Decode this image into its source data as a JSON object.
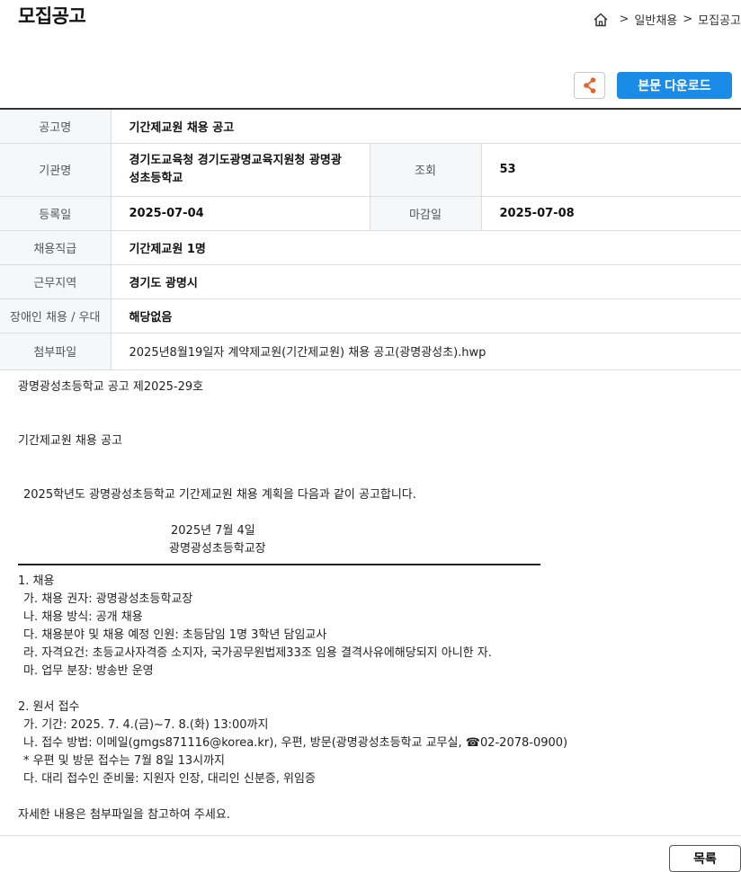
{
  "header": {
    "title": "모집공고",
    "breadcrumb": [
      ">",
      "일반채용",
      ">",
      "모집공고"
    ]
  },
  "actions": {
    "share_icon": "share-icon",
    "download_label": "본문 다운로드"
  },
  "info": {
    "notice_name_label": "공고명",
    "notice_name": "기간제교원 채용 공고",
    "org_label": "기관명",
    "org": "경기도교육청 경기도광명교육지원청 광명광성초등학교",
    "views_label": "조회",
    "views": "53",
    "reg_date_label": "등록일",
    "reg_date": "2025-07-04",
    "deadline_label": "마감일",
    "deadline": "2025-07-08",
    "position_label": "채용직급",
    "position": "기간제교원 1명",
    "region_label": "근무지역",
    "region": "경기도 광명시",
    "disabled_label": "장애인 채용 / 우대",
    "disabled": "해당없음",
    "attachment_label": "첨부파일",
    "attachment": "2025년8월19일자 계약제교원(기간제교원) 채용 공고(광명광성초).hwp"
  },
  "content": {
    "line1": "광명광성초등학교 공고 제2025-29호",
    "line2": "기간제교원 채용 공고",
    "line3": "2025학년도 광명광성초등학교 기간제교원 채용 계획을 다음과 같이 공고합니다.",
    "date": "2025년 7월 4일",
    "signer": "광명광성초등학교장",
    "s1_title": "1. 채용",
    "s1_a": "가. 채용 권자: 광명광성초등학교장",
    "s1_b": "나. 채용 방식: 공개 채용",
    "s1_c": "다. 채용분야 및 채용 예정 인원: 초등담임 1명 3학년 담임교사",
    "s1_d": "라. 자격요건: 초등교사자격증 소지자, 국가공무원법제33조 임용 결격사유에해당되지 아니한 자.",
    "s1_e": "마. 업무 분장: 방송반 운영",
    "s2_title": "2. 원서 접수",
    "s2_a": "가. 기간: 2025. 7. 4.(금)~7. 8.(화) 13:00까지",
    "s2_b": "나. 접수 방법: 이메일(gmgs871116@korea.kr), 우편, 방문(광명광성초등학교 교무실, ☎02-2078-0900)",
    "s2_note": " * 우편 및 방문 접수는 7월 8일 13시까지",
    "s2_c": "다. 대리 접수인 준비물: 지원자 인장, 대리인 신분증, 위임증",
    "footer": "자세한 내용은 첨부파일을 참고하여 주세요."
  },
  "footer": {
    "list_label": "목록"
  },
  "colors": {
    "accent": "#1a8be6",
    "share_icon": "#e8622a"
  }
}
